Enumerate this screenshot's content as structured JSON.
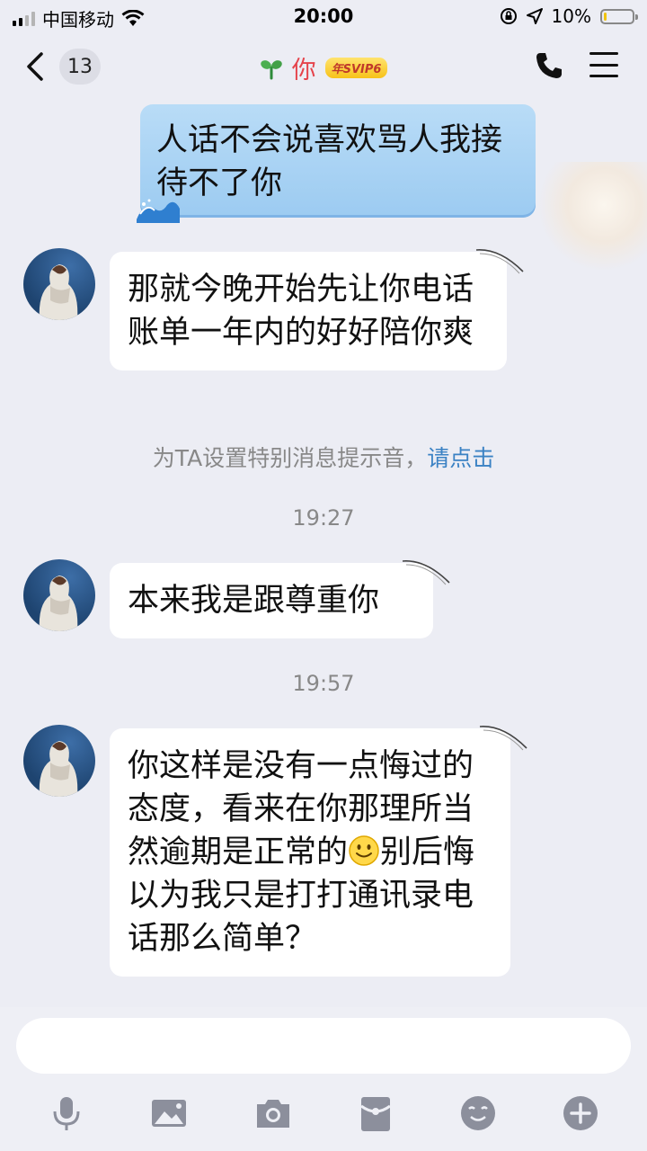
{
  "status_bar": {
    "carrier": "中国移动",
    "time": "20:00",
    "battery": "10%",
    "battery_level": 0.1
  },
  "nav": {
    "unread_count": "13",
    "contact_name": "你",
    "vip_badge": "年SVIP6"
  },
  "messages": [
    {
      "side": "out",
      "text": "人话不会说喜欢骂人我接待不了你"
    },
    {
      "side": "in",
      "text": "那就今晚开始先让你电话账单一年内的好好陪你爽"
    },
    {
      "side": "in",
      "text": "本来我是跟尊重你"
    },
    {
      "side": "in",
      "text_part1": "你这样是没有一点悔过的态度，看来在你那理所当然逾期是正常的",
      "text_part2": "别后悔以为我只是打打通讯录电话那么简单？"
    }
  ],
  "hint": {
    "text": "为TA设置特别消息提示音，",
    "link": "请点击"
  },
  "timestamps": [
    "19:27",
    "19:57"
  ],
  "icons": {
    "mic": "microphone-icon",
    "image": "image-icon",
    "camera": "camera-icon",
    "red_packet": "red-packet-icon",
    "emoji": "emoji-icon",
    "plus": "plus-icon"
  }
}
